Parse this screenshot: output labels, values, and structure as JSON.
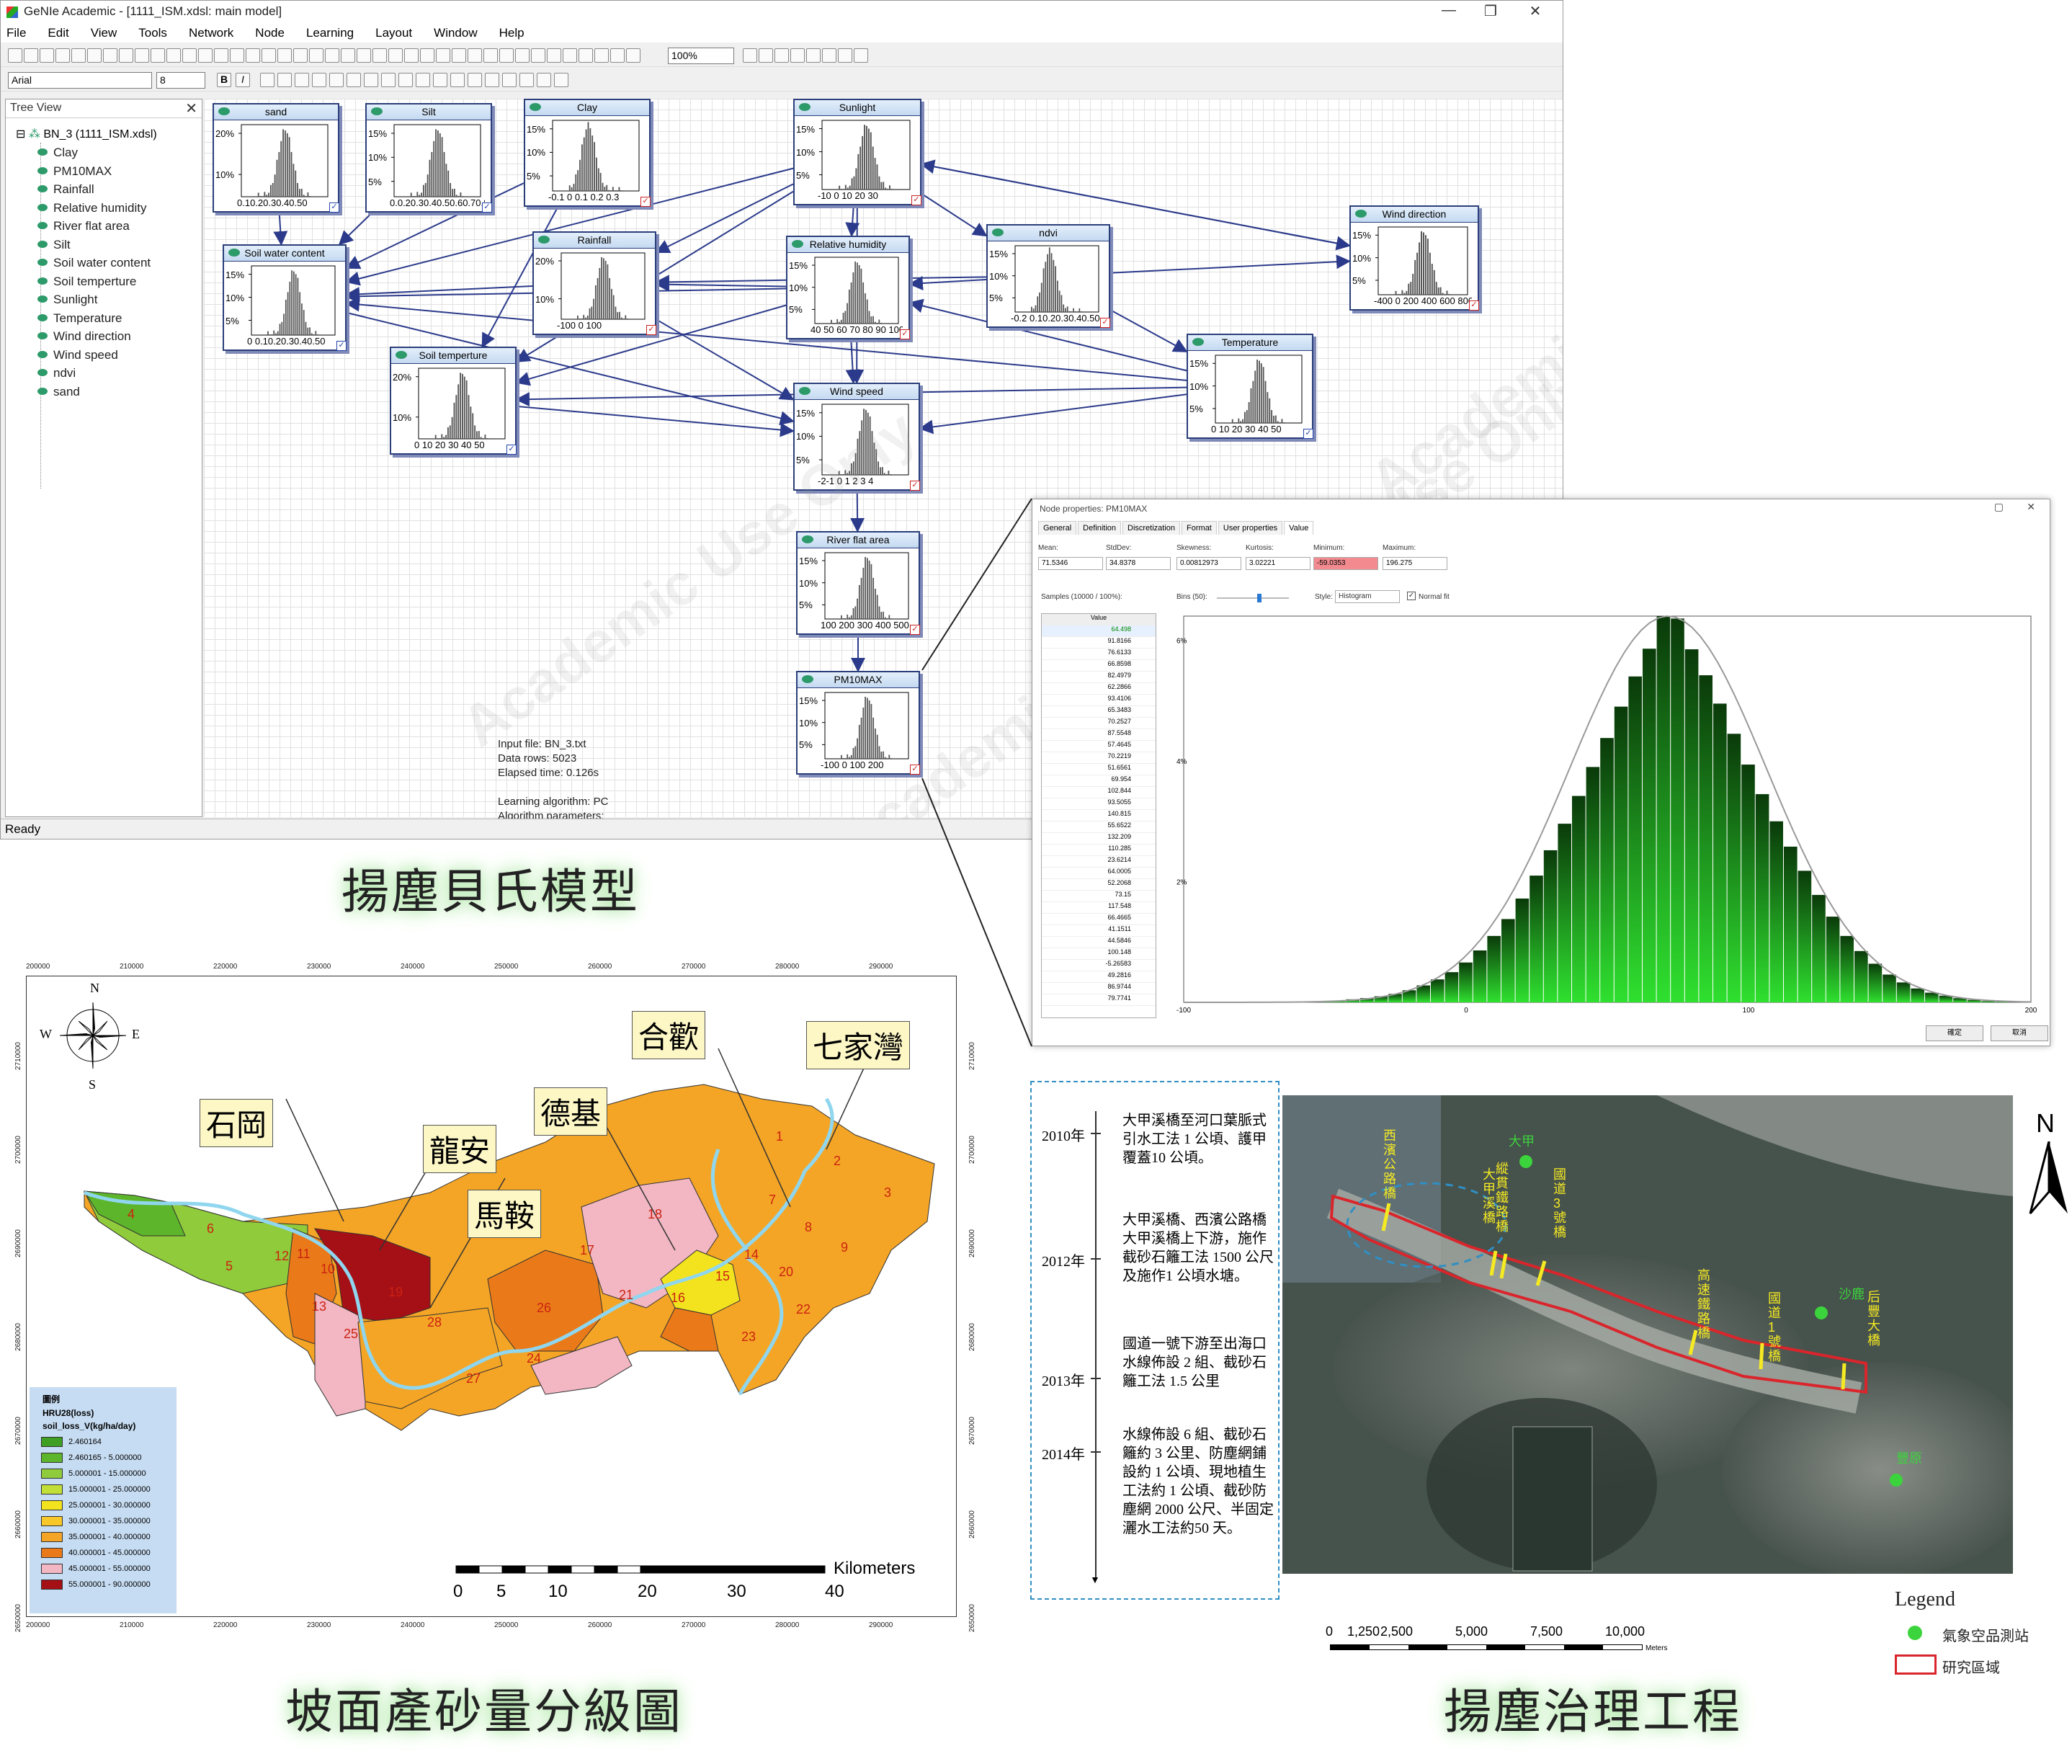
{
  "window": {
    "title": "GeNIe Academic - [1111_ISM.xdsl: main model]",
    "min": "—",
    "max": "❐",
    "close": "✕"
  },
  "menu": [
    "File",
    "Edit",
    "View",
    "Tools",
    "Network",
    "Node",
    "Learning",
    "Layout",
    "Window",
    "Help"
  ],
  "toolbar": {
    "zoom": "100%",
    "font": "Arial",
    "font_size": "8",
    "bold": "B",
    "italic": "I"
  },
  "tree": {
    "header": "Tree View",
    "root": "BN_3 (1111_ISM.xdsl)",
    "items": [
      "Clay",
      "PM10MAX",
      "Rainfall",
      "Relative humidity",
      "River flat area",
      "Silt",
      "Soil water content",
      "Soil temperture",
      "Sunlight",
      "Temperature",
      "Wind direction",
      "Wind speed",
      "ndvi",
      "sand"
    ]
  },
  "status": "Ready",
  "nodes": [
    {
      "name": "sand",
      "yticks": [
        "20%",
        "10%"
      ],
      "xlabels": "0.10.20.30.40.50"
    },
    {
      "name": "Silt",
      "yticks": [
        "15%",
        "10%",
        "5%"
      ],
      "xlabels": "0.0.20.30.40.50.60.70.8"
    },
    {
      "name": "Clay",
      "yticks": [
        "15%",
        "10%",
        "5%"
      ],
      "xlabels": "-0.1  0  0.1 0.2 0.3"
    },
    {
      "name": "Sunlight",
      "yticks": [
        "15%",
        "10%",
        "5%"
      ],
      "xlabels": "-10  0  10  20  30"
    },
    {
      "name": "Soil  water content",
      "yticks": [
        "15%",
        "10%",
        "5%"
      ],
      "xlabels": "0 0.10.20.30.40.50"
    },
    {
      "name": "Rainfall",
      "yticks": [
        "20%",
        "10%"
      ],
      "xlabels": "-100     0     100"
    },
    {
      "name": "Relative humidity",
      "yticks": [
        "15%",
        "10%",
        "5%"
      ],
      "xlabels": "40 50 60 70 80 90 100"
    },
    {
      "name": "ndvi",
      "yticks": [
        "15%",
        "10%",
        "5%"
      ],
      "xlabels": "-0.2 0.10.20.30.40.50.6"
    },
    {
      "name": "Wind direction",
      "yticks": [
        "15%",
        "10%",
        "5%"
      ],
      "xlabels": "-400 0 200 400 600 800"
    },
    {
      "name": "Soil temperture",
      "yticks": [
        "20%",
        "10%"
      ],
      "xlabels": "0  10  20  30  40  50"
    },
    {
      "name": "Temperature",
      "yticks": [
        "15%",
        "10%",
        "5%"
      ],
      "xlabels": "0  10  20  30  40  50"
    },
    {
      "name": "Wind speed",
      "yticks": [
        "15%",
        "10%",
        "5%"
      ],
      "xlabels": "-2-1 0 1 2 3 4"
    },
    {
      "name": "River flat area",
      "yticks": [
        "15%",
        "10%",
        "5%"
      ],
      "xlabels": "100 200 300 400 500"
    },
    {
      "name": "PM10MAX",
      "yticks": [
        "15%",
        "10%",
        "5%"
      ],
      "xlabels": "-100   0   100  200"
    }
  ],
  "info_text": "Input file: BN_3.txt\nData rows: 5023\nElapsed time: 0.126s\n\nLearning algorithm: PC\nAlgorithm parameters:\nMax adjacency: 8\nSignificance: 0.05\nMax search time: 0\nNo background knowledge\n\nEM Log Likelihood: 0",
  "watermark": "Academic Use Only",
  "props": {
    "title": "Node properties: PM10MAX",
    "tabs": [
      "General",
      "Definition",
      "Discretization",
      "Format",
      "User properties",
      "Value"
    ],
    "stats": [
      {
        "label": "Mean:",
        "value": "71.5346"
      },
      {
        "label": "StdDev:",
        "value": "34.8378"
      },
      {
        "label": "Skewness:",
        "value": "0.00812973"
      },
      {
        "label": "Kurtosis:",
        "value": "3.02221"
      },
      {
        "label": "Minimum:",
        "value": "-59.0353"
      },
      {
        "label": "Maximum:",
        "value": "196.275"
      }
    ],
    "samples_label": "Samples (10000 / 100%):",
    "bins_label": "Bins (50):",
    "style_label": "Style:",
    "style_value": "Histogram",
    "normal_fit": "Normal fit",
    "value_header": "Value",
    "values": [
      "64.498",
      "91.8166",
      "76.6133",
      "66.8598",
      "82.4979",
      "62.2866",
      "93.4106",
      "65.3483",
      "70.2527",
      "87.5548",
      "57.4645",
      "70.2219",
      "51.6561",
      "69.954",
      "102.844",
      "93.5055",
      "140.815",
      "55.6522",
      "132.209",
      "110.285",
      "23.6214",
      "64.0005",
      "52.2068",
      "73.15",
      "117.548",
      "66.4665",
      "41.1511",
      "44.5846",
      "100.148",
      "-5.26583",
      "49.2816",
      "86.9744",
      "79.7741"
    ],
    "x_ticks": [
      "-100",
      "0",
      "100",
      "200"
    ],
    "y_ticks": [
      "6%",
      "4%",
      "2%"
    ],
    "ok": "確定",
    "cancel": "取消"
  },
  "hist_data": {
    "type": "bar",
    "x": [
      -50,
      -45,
      -40,
      -35,
      -30,
      -25,
      -20,
      -15,
      -10,
      -5,
      0,
      5,
      10,
      15,
      20,
      25,
      30,
      35,
      40,
      45,
      50,
      55,
      60,
      65,
      70,
      75,
      80,
      85,
      90,
      95,
      100,
      105,
      110,
      115,
      120,
      125,
      130,
      135,
      140,
      145,
      150,
      155,
      160,
      165,
      170,
      175,
      180,
      185,
      190
    ],
    "values": [
      0.02,
      0.03,
      0.05,
      0.07,
      0.1,
      0.14,
      0.2,
      0.28,
      0.38,
      0.5,
      0.66,
      0.86,
      1.1,
      1.38,
      1.72,
      2.1,
      2.52,
      2.96,
      3.42,
      3.9,
      4.38,
      4.9,
      5.4,
      5.86,
      6.4,
      6.36,
      5.85,
      5.42,
      4.95,
      4.45,
      3.94,
      3.45,
      3.0,
      2.58,
      2.18,
      1.78,
      1.42,
      1.1,
      0.85,
      0.64,
      0.46,
      0.33,
      0.23,
      0.16,
      0.11,
      0.07,
      0.04,
      0.02,
      0.01
    ],
    "xlim": [
      -100,
      200
    ],
    "ylim": [
      0,
      6.4
    ]
  },
  "captions": {
    "bayes": "揚塵貝氏模型",
    "map": "坡面產砂量分級圖",
    "works": "揚塵治理工程"
  },
  "map1": {
    "x_coords": [
      "200000",
      "210000",
      "220000",
      "230000",
      "240000",
      "250000",
      "260000",
      "270000",
      "280000",
      "290000"
    ],
    "y_coords": [
      "2710000",
      "2700000",
      "2690000",
      "2680000",
      "2670000",
      "2660000",
      "2650000"
    ],
    "places": [
      "石岡",
      "龍安",
      "馬鞍",
      "德基",
      "合歡",
      "七家灣"
    ],
    "compass": {
      "n": "N",
      "s": "S",
      "e": "E",
      "w": "W"
    },
    "scale_label": "Kilometers",
    "scale_ticks": [
      "0",
      "5",
      "10",
      "20",
      "30",
      "40"
    ],
    "subbasins": [
      "1",
      "2",
      "3",
      "4",
      "5",
      "6",
      "7",
      "8",
      "9",
      "10",
      "11",
      "12",
      "13",
      "14",
      "15",
      "16",
      "17",
      "18",
      "19",
      "20",
      "21",
      "22",
      "23",
      "24",
      "25",
      "26",
      "27",
      "28"
    ],
    "legend": {
      "title1": "圖例",
      "title2": "HRU28(loss)",
      "title3": "soil_loss_V(kg/ha/day)",
      "classes": [
        {
          "label": "2.460164",
          "color": "#3f9f22"
        },
        {
          "label": "2.460165 - 5.000000",
          "color": "#5db52b"
        },
        {
          "label": "5.000001 - 15.000000",
          "color": "#8fcb3a"
        },
        {
          "label": "15.000001 - 25.000000",
          "color": "#c2df38"
        },
        {
          "label": "25.000001 - 30.000000",
          "color": "#f3e31f"
        },
        {
          "label": "30.000001 - 35.000000",
          "color": "#f8c72a"
        },
        {
          "label": "35.000001 - 40.000000",
          "color": "#f4a526"
        },
        {
          "label": "40.000001 - 45.000000",
          "color": "#ea7a19"
        },
        {
          "label": "45.000001 - 55.000000",
          "color": "#f2b7c3"
        },
        {
          "label": "55.000001 - 90.000000",
          "color": "#a50f16"
        }
      ]
    }
  },
  "timeline": [
    {
      "year": "2010年",
      "text": "大甲溪橋至河口葉脈式引水工法 1 公頃、護甲覆蓋10 公頃。"
    },
    {
      "year": "2012年",
      "text": "大甲溪橋、西濱公路橋大甲溪橋上下游，施作截砂石籬工法 1500 公尺及施作1 公頃水塘。"
    },
    {
      "year": "2013年",
      "text": "國道一號下游至出海口水線佈設 2 組、截砂石籬工法 1.5 公里"
    },
    {
      "year": "2014年",
      "text": "水線佈設 6 組、截砂石籬約 3 公里、防塵網鋪設約 1 公頃、現地植生工法約 1 公頃、截砂防塵網 2000 公尺、半固定灑水工法約50 天。"
    }
  ],
  "sat": {
    "bridges": [
      "西濱公路橋",
      "縱貫鐵路橋",
      "大甲溪橋",
      "國道3號橋",
      "高速鐵路橋",
      "國道1號橋",
      "后豐大橋"
    ],
    "stations": [
      "大甲",
      "沙鹿",
      "豐原"
    ],
    "north": "N",
    "legend_title": "Legend",
    "legend_station": "氣象空品測站",
    "legend_area": "研究區域",
    "scale_ticks": [
      "0",
      "1,250",
      "2,500",
      "5,000",
      "7,500",
      "10,000"
    ],
    "scale_unit": "Meters",
    "colors": {
      "river": "#d9252b",
      "station": "#3cd43c",
      "bridge": "#f5ea22"
    }
  }
}
